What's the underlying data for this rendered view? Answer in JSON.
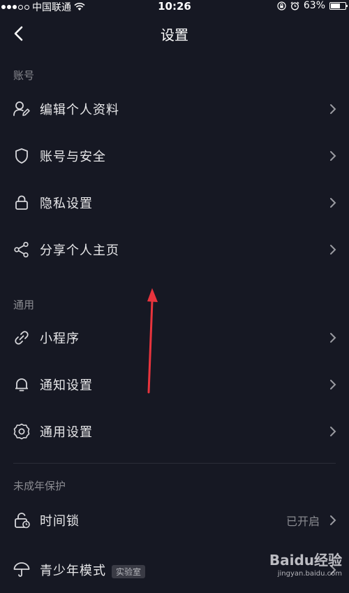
{
  "status_bar": {
    "carrier": "中国联通",
    "time": "10:26",
    "battery_percent": "63%",
    "battery_level": 0.63
  },
  "header": {
    "title": "设置"
  },
  "sections": {
    "account": {
      "label": "账号",
      "items": [
        {
          "label": "编辑个人资料",
          "icon": "edit-profile-icon"
        },
        {
          "label": "账号与安全",
          "icon": "shield-icon"
        },
        {
          "label": "隐私设置",
          "icon": "lock-icon"
        },
        {
          "label": "分享个人主页",
          "icon": "share-icon"
        }
      ]
    },
    "general": {
      "label": "通用",
      "items": [
        {
          "label": "小程序",
          "icon": "mini-program-icon"
        },
        {
          "label": "通知设置",
          "icon": "bell-icon"
        },
        {
          "label": "通用设置",
          "icon": "gear-icon"
        }
      ]
    },
    "minor": {
      "label": "未成年保护",
      "items": [
        {
          "label": "时间锁",
          "icon": "time-lock-icon",
          "value": "已开启"
        },
        {
          "label": "青少年模式",
          "icon": "umbrella-icon",
          "badge": "实验室"
        }
      ]
    }
  },
  "watermark": {
    "main": "Baidu经验",
    "sub": "jingyan.baidu.com"
  },
  "colors": {
    "background": "#161823",
    "text": "#e8e8ea",
    "muted": "#8a8b91",
    "annotation_arrow": "#e8343d"
  }
}
